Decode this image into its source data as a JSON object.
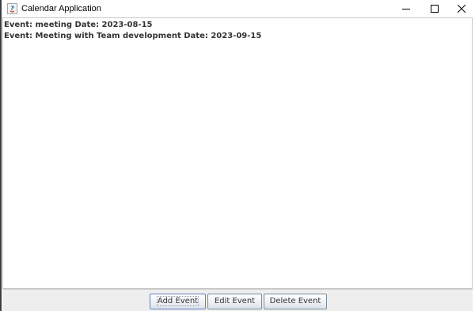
{
  "window": {
    "title": "Calendar Application",
    "controls": {
      "minimize_icon": "minimize-icon",
      "maximize_icon": "maximize-icon",
      "close_icon": "close-icon"
    }
  },
  "events": [
    {
      "text": "Event: meeting Date: 2023-08-15"
    },
    {
      "text": "Event: Meeting with Team development Date: 2023-09-15"
    }
  ],
  "buttons": {
    "add": "Add Event",
    "edit": "Edit Event",
    "delete": "Delete Event"
  },
  "colors": {
    "title_bar": "#ffffff",
    "button_bar": "#eeeeee",
    "button_border": "#7a8a99",
    "text": "#333333"
  }
}
